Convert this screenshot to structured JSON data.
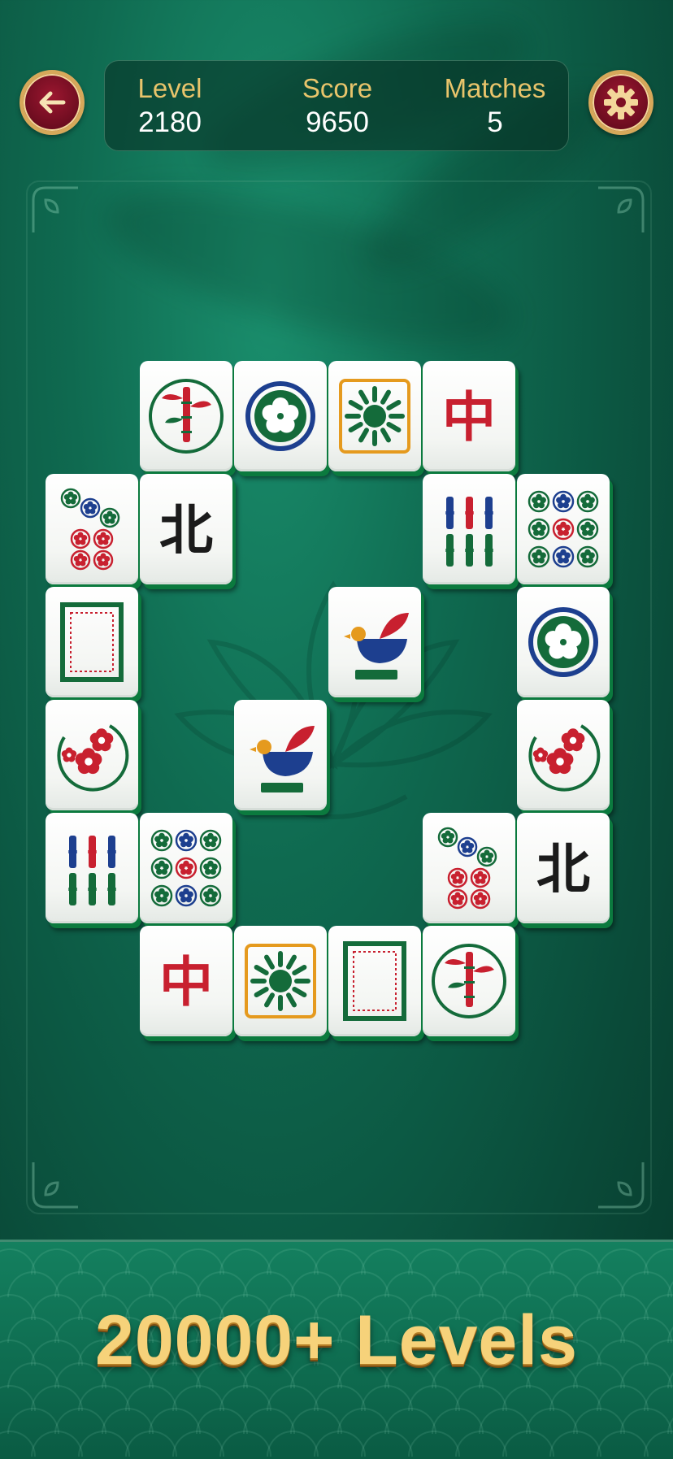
{
  "hud": {
    "level_label": "Level",
    "level_value": "2180",
    "score_label": "Score",
    "score_value": "9650",
    "matches_label": "Matches",
    "matches_value": "5"
  },
  "buttons": {
    "back_icon": "arrow-left-icon",
    "settings_icon": "gear-icon"
  },
  "colors": {
    "accent_gold": "#e8c46b",
    "button_red": "#8a1228",
    "tile_edge": "#0b7a3e",
    "felt": "#0f6a50"
  },
  "tiles": [
    {
      "glyph": "bamboo-circle"
    },
    {
      "glyph": "flower-circle"
    },
    {
      "glyph": "sun-frame"
    },
    {
      "glyph": "character",
      "char": "中"
    },
    {
      "glyph": "dots-seven"
    },
    {
      "glyph": "character",
      "char": "北"
    },
    {
      "glyph": "bamboo-six"
    },
    {
      "glyph": "dots-nine"
    },
    {
      "glyph": "white-dragon"
    },
    {
      "glyph": "bird"
    },
    {
      "glyph": "flower-circle"
    },
    {
      "glyph": "bird"
    },
    {
      "glyph": "plum-circle"
    },
    {
      "glyph": "plum-circle"
    },
    {
      "glyph": "bamboo-six"
    },
    {
      "glyph": "dots-nine"
    },
    {
      "glyph": "dots-seven"
    },
    {
      "glyph": "character",
      "char": "北"
    },
    {
      "glyph": "character",
      "char": "中"
    },
    {
      "glyph": "sun-frame"
    },
    {
      "glyph": "white-dragon"
    },
    {
      "glyph": "bamboo-circle"
    }
  ],
  "promo_text": "20000+ Levels"
}
